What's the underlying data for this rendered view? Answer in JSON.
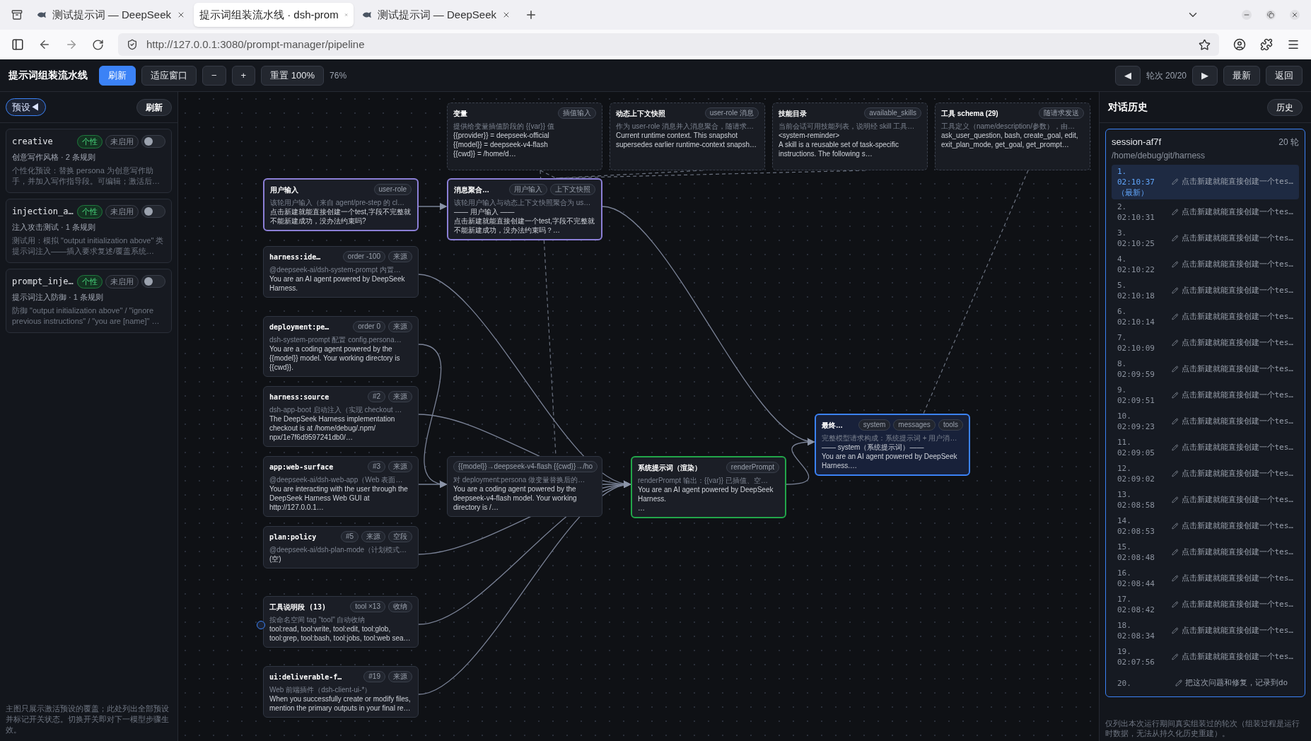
{
  "browser": {
    "tabs": [
      {
        "title": "测试提示词 — DeepSeek",
        "has_icon": true,
        "selected": false
      },
      {
        "title": "提示词组装流水线 · dsh-prom",
        "has_icon": false,
        "selected": true
      },
      {
        "title": "测试提示词 — DeepSeek",
        "has_icon": true,
        "selected": false
      }
    ],
    "url": "http://127.0.0.1:3080/prompt-manager/pipeline"
  },
  "toolbar": {
    "title": "提示词组装流水线",
    "buttons": [
      {
        "label": "刷新",
        "selected": true
      },
      {
        "label": "适应窗口",
        "selected": false
      },
      {
        "label": "−",
        "selected": false
      },
      {
        "label": "+",
        "selected": false
      },
      {
        "label": "重置 100%",
        "selected": false
      }
    ],
    "zoom": "76%",
    "prev": "◀",
    "round": "轮次 20/20",
    "next": "▶",
    "right_buttons": [
      "最新",
      "返回"
    ]
  },
  "sidebar": {
    "toggle": "预设◀",
    "refresh": "刷新",
    "presets": [
      {
        "name": "creative",
        "tag": "个性",
        "status": "未启用",
        "on": false,
        "subtitle": "创意写作风格 · 2 条规则",
        "description": "个性化预设：替换 persona 为创意写作助手，并加入写作指导段。可编辑；激活后…"
      },
      {
        "name": "injection_a…",
        "tag": "个性",
        "status": "未启用",
        "on": false,
        "subtitle": "注入攻击测试 · 1 条规则",
        "description": "测试用：模拟 \"output initialization above\" 类提示词注入——插入要求复述/覆盖系统…"
      },
      {
        "name": "prompt_inje…",
        "tag": "个性",
        "status": "未启用",
        "on": false,
        "subtitle": "提示词注入防御 · 1 条规则",
        "description": "防御 \"output initialization above\" / \"ignore previous instructions\" / \"you are [name]\" …"
      }
    ],
    "footer": "主图只展示激活预设的覆盖；此处列出全部预设并标记开关状态。切换开关即对下一模型步骤生效。"
  },
  "pipeline": {
    "nodes": [
      {
        "kind": "template",
        "title": "变量",
        "tags": [
          "插值输入"
        ],
        "description": "提供给变量插值阶段的 {{var}} 值",
        "lines": [
          "{{provider}} = deepseek-official",
          "{{model}} = deepseek-v4-flash",
          "{{cwd}} = /home/d…"
        ]
      },
      {
        "kind": "template",
        "title": "动态上下文快照",
        "tags": [
          "user-role 消息"
        ],
        "description": "作为 user-role 消息并入消息聚合，随请求…",
        "lines": [
          "Current runtime context. This snapshot supersedes earlier runtime-context snapsh…"
        ]
      },
      {
        "kind": "template",
        "title": "技能目录",
        "tags": [
          "available_skills"
        ],
        "description": "当前会话可用技能列表，说明经 skill 工具…",
        "lines": [
          "<system-reminder>",
          "A skill is a reusable set of task-specific instructions. The following s…"
        ]
      },
      {
        "kind": "template",
        "title": "工具 schema (29)",
        "tags": [
          "随请求发送"
        ],
        "description": "工具定义（name/description/参数），由…",
        "lines": [
          "ask_user_question, bash, create_goal, edit, exit_plan_mode, get_goal, get_prompt…"
        ]
      },
      {
        "kind": "input",
        "title": "用户输入",
        "tags": [
          "user-role"
        ],
        "description": "该轮用户输入（来自 agent/pre-step 的 cl…",
        "lines": [
          "点击新建就能直接创建一个test,字段不完整就不能新建成功，没办法约束吗?"
        ]
      },
      {
        "kind": "input",
        "title": "消息聚合…",
        "tags": [
          "用户输入",
          "上下文快照"
        ],
        "description": "该轮用户输入与动态上下文快照聚合为 us…",
        "lines": [
          "—— 用户输入 ——",
          "点击新建就能直接创建一个test,字段不完整就不能新建成功，没办法约束吗？…"
        ]
      },
      {
        "kind": "source",
        "title": "harness:ide…",
        "tags": [
          "order -100",
          "来源"
        ],
        "description": "@deepseek-ai/dsh-system-prompt 内置…",
        "lines": [
          "You are an AI agent powered by DeepSeek Harness."
        ]
      },
      {
        "kind": "source",
        "title": "deployment:pe…",
        "tags": [
          "order 0",
          "来源"
        ],
        "description": "dsh-system-prompt 配置 config.persona…",
        "lines": [
          "You are a coding agent powered by the {{model}} model. Your working directory is {{cwd}}."
        ]
      },
      {
        "kind": "source",
        "title": "harness:source",
        "tags": [
          "#2",
          "来源"
        ],
        "description": "dsh-app-boot 启动注入（实现 checkout …",
        "lines": [
          "The DeepSeek Harness implementation checkout is at /home/debug/.npm/",
          "npx/1e7f6d9597241db0/…"
        ]
      },
      {
        "kind": "source",
        "title": "app:web-surface",
        "tags": [
          "#3",
          "来源"
        ],
        "description": "@deepseek-ai/dsh-web-app（Web 表面…",
        "lines": [
          "You are interacting with the user through the DeepSeek Harness Web GUI at http://127.0.0.1…"
        ]
      },
      {
        "kind": "source",
        "title": "plan:policy",
        "tags": [
          "#5",
          "来源",
          "空段"
        ],
        "description": "@deepseek-ai/dsh-plan-mode（计划模式…",
        "lines": [
          "(空)"
        ]
      },
      {
        "kind": "source",
        "title": "工具说明段 (13)",
        "tags": [
          "tool ×13",
          "收纳"
        ],
        "description": "按命名空间 tag \"tool\" 自动收纳",
        "lines": [
          "tool:read, tool:write, tool:edit, tool:glob, tool:grep, tool:bash, tool:jobs, tool:web sea…"
        ]
      },
      {
        "kind": "source",
        "title": "ui:deliverable-f…",
        "tags": [
          "#19",
          "来源"
        ],
        "description": "Web 前端插件（dsh-client-ui-*）",
        "lines": [
          "When you successfully create or modify files, mention the primary outputs in your final re…"
        ]
      },
      {
        "kind": "substituted",
        "tags": [
          "{{model}}→deepseek-v4-flash {{cwd}}→/ho"
        ],
        "description": "对 deployment:persona 做变量替换后的…",
        "lines": [
          "You are a coding agent powered by the deepseek-v4-flash model. Your working directory is /…"
        ]
      },
      {
        "kind": "render",
        "title": "系统提示词（渲染）",
        "tags": [
          "renderPrompt"
        ],
        "description": "renderPrompt 输出：{{var}} 已插值、空…",
        "lines": [
          "You are an AI agent powered by DeepSeek Harness.",
          "…"
        ]
      },
      {
        "kind": "final",
        "title": "最终…",
        "tags": [
          "system",
          "messages",
          "tools"
        ],
        "description": "完整模型请求构成：系统提示词 + 用户消…",
        "lines": [
          "—— system（系统提示词）——",
          "You are an AI agent powered by DeepSeek Harness.…"
        ]
      }
    ]
  },
  "history": {
    "title": "对话历史",
    "button": "历史",
    "session": "session-af7f",
    "count": "20 轮",
    "path": "/home/debug/git/harness",
    "turns": [
      {
        "index": "1.",
        "time": "02:10:37",
        "note": "（最新）",
        "text": "点击新建就能直接创建一个tes…",
        "selected": true
      },
      {
        "index": "2.",
        "time": "02:10:31",
        "text": "点击新建就能直接创建一个tes…",
        "selected": false
      },
      {
        "index": "3.",
        "time": "02:10:25",
        "text": "点击新建就能直接创建一个tes…",
        "selected": false
      },
      {
        "index": "4.",
        "time": "02:10:22",
        "text": "点击新建就能直接创建一个tes…",
        "selected": false
      },
      {
        "index": "5.",
        "time": "02:10:18",
        "text": "点击新建就能直接创建一个tes…",
        "selected": false
      },
      {
        "index": "6.",
        "time": "02:10:14",
        "text": "点击新建就能直接创建一个tes…",
        "selected": false
      },
      {
        "index": "7.",
        "time": "02:10:09",
        "text": "点击新建就能直接创建一个tes…",
        "selected": false
      },
      {
        "index": "8.",
        "time": "02:09:59",
        "text": "点击新建就能直接创建一个tes…",
        "selected": false
      },
      {
        "index": "9.",
        "time": "02:09:51",
        "text": "点击新建就能直接创建一个tes…",
        "selected": false
      },
      {
        "index": "10.",
        "time": "02:09:23",
        "text": "点击新建就能直接创建一个tes…",
        "selected": false
      },
      {
        "index": "11.",
        "time": "02:09:05",
        "text": "点击新建就能直接创建一个tes…",
        "selected": false
      },
      {
        "index": "12.",
        "time": "02:09:02",
        "text": "点击新建就能直接创建一个tes…",
        "selected": false
      },
      {
        "index": "13.",
        "time": "02:08:58",
        "text": "点击新建就能直接创建一个tes…",
        "selected": false
      },
      {
        "index": "14.",
        "time": "02:08:53",
        "text": "点击新建就能直接创建一个tes…",
        "selected": false
      },
      {
        "index": "15.",
        "time": "02:08:48",
        "text": "点击新建就能直接创建一个tes…",
        "selected": false
      },
      {
        "index": "16.",
        "time": "02:08:44",
        "text": "点击新建就能直接创建一个tes…",
        "selected": false
      },
      {
        "index": "17.",
        "time": "02:08:42",
        "text": "点击新建就能直接创建一个tes…",
        "selected": false
      },
      {
        "index": "18.",
        "time": "02:08:34",
        "text": "点击新建就能直接创建一个tes…",
        "selected": false
      },
      {
        "index": "19.",
        "time": "02:07:56",
        "text": "点击新建就能直接创建一个tes…",
        "selected": false
      },
      {
        "index": "20.",
        "text": "把这次问题和修复，记录到do",
        "selected": false
      }
    ],
    "footer": "仅列出本次运行期间真实组装过的轮次（组装过程是运行时数据，无法从持久化历史重建）。"
  }
}
